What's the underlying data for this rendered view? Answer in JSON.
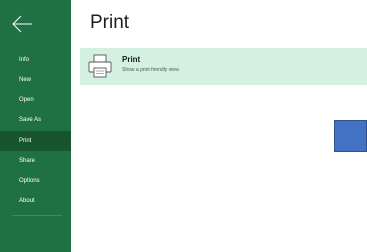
{
  "sidebar": {
    "items": [
      {
        "label": "Info"
      },
      {
        "label": "New"
      },
      {
        "label": "Open"
      },
      {
        "label": "Save As"
      },
      {
        "label": "Print",
        "selected": true
      },
      {
        "label": "Share"
      },
      {
        "label": "Options"
      },
      {
        "label": "About"
      }
    ]
  },
  "main": {
    "title": "Print",
    "print_option": {
      "label": "Print",
      "description": "Show a print friendly view."
    }
  },
  "colors": {
    "sidebar": "#1f7144",
    "sidebar_selected": "#17552f",
    "option_bg": "#d4f0e1",
    "blue_square": "#4472c4"
  }
}
